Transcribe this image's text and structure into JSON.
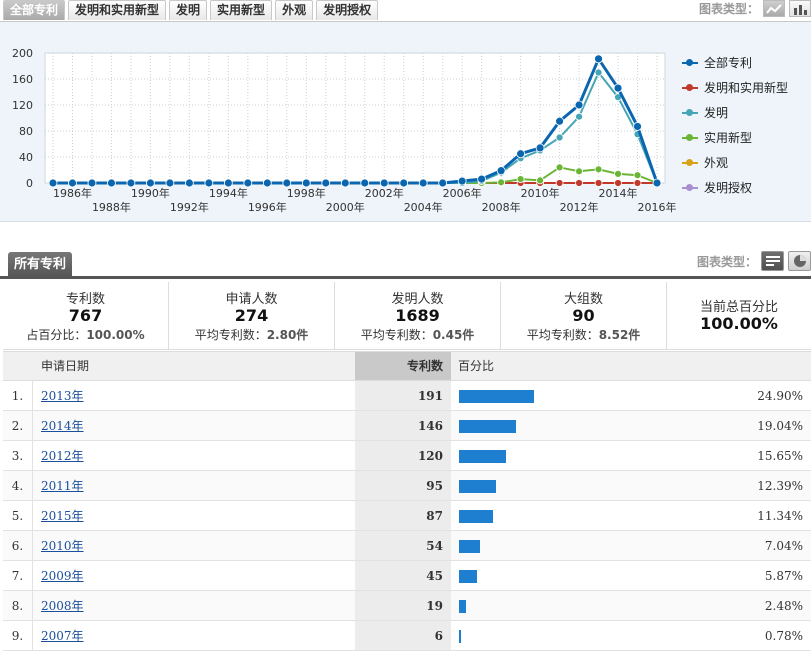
{
  "tabs": [
    "全部专利",
    "发明和实用新型",
    "发明",
    "实用新型",
    "外观",
    "发明授权"
  ],
  "chart_type_label": "图表类型：",
  "chart_data": {
    "type": "line",
    "x": [
      1985,
      1986,
      1987,
      1988,
      1989,
      1990,
      1991,
      1992,
      1993,
      1994,
      1995,
      1996,
      1997,
      1998,
      1999,
      2000,
      2001,
      2002,
      2003,
      2004,
      2005,
      2006,
      2007,
      2008,
      2009,
      2010,
      2011,
      2012,
      2013,
      2014,
      2015,
      2016
    ],
    "x_tick_labels": [
      "1986年",
      "1988年",
      "1990年",
      "1992年",
      "1994年",
      "1996年",
      "1998年",
      "2000年",
      "2002年",
      "2004年",
      "2006年",
      "2008年",
      "2010年",
      "2012年",
      "2014年",
      "2016年"
    ],
    "ylim": [
      0,
      200
    ],
    "y_ticks": [
      0,
      40,
      80,
      120,
      160,
      200
    ],
    "grid": true,
    "legend_position": "right",
    "series": [
      {
        "name": "全部专利",
        "color": "#0b66b0",
        "values": [
          0,
          0,
          0,
          0,
          0,
          0,
          0,
          0,
          0,
          0,
          0,
          0,
          0,
          0,
          0,
          0,
          0,
          0,
          0,
          0,
          0,
          3,
          6,
          19,
          45,
          54,
          95,
          120,
          191,
          146,
          87,
          0
        ]
      },
      {
        "name": "发明和实用新型",
        "color": "#c0392b",
        "values": [
          0,
          0,
          0,
          0,
          0,
          0,
          0,
          0,
          0,
          0,
          0,
          0,
          0,
          0,
          0,
          0,
          0,
          0,
          0,
          0,
          0,
          0,
          0,
          0,
          0,
          0,
          0,
          0,
          0,
          0,
          0,
          0
        ]
      },
      {
        "name": "发明",
        "color": "#45a5b5",
        "values": [
          0,
          0,
          0,
          0,
          0,
          0,
          0,
          0,
          0,
          0,
          0,
          0,
          0,
          0,
          0,
          0,
          0,
          0,
          0,
          0,
          0,
          0,
          3,
          16,
          38,
          50,
          70,
          102,
          170,
          132,
          75,
          0
        ]
      },
      {
        "name": "实用新型",
        "color": "#6ab535",
        "values": [
          0,
          0,
          0,
          0,
          0,
          0,
          0,
          0,
          0,
          0,
          0,
          0,
          0,
          0,
          0,
          0,
          0,
          0,
          0,
          0,
          0,
          0,
          0,
          1,
          6,
          4,
          24,
          18,
          21,
          14,
          12,
          0
        ]
      },
      {
        "name": "外观",
        "color": "#d6a21a",
        "values": [
          0,
          0,
          0,
          0,
          0,
          0,
          0,
          0,
          0,
          0,
          0,
          0,
          0,
          0,
          0,
          0,
          0,
          0,
          0,
          0,
          0,
          0,
          0,
          0,
          0,
          0,
          0,
          0,
          0,
          0,
          0,
          0
        ]
      },
      {
        "name": "发明授权",
        "color": "#a98fd0",
        "values": [
          0,
          0,
          0,
          0,
          0,
          0,
          0,
          0,
          0,
          0,
          0,
          0,
          0,
          0,
          0,
          0,
          0,
          0,
          0,
          0,
          0,
          0,
          0,
          0,
          0,
          0,
          0,
          0,
          0,
          0,
          0,
          0
        ]
      }
    ]
  },
  "section_tab": "所有专利",
  "stats": {
    "patents": {
      "title": "专利数",
      "value": "767",
      "sub_label": "占百分比：",
      "sub_value": "100.00%"
    },
    "applicants": {
      "title": "申请人数",
      "value": "274",
      "sub_label": "平均专利数：",
      "sub_value": "2.80件"
    },
    "inventors": {
      "title": "发明人数",
      "value": "1689",
      "sub_label": "平均专利数：",
      "sub_value": "0.45件"
    },
    "groups": {
      "title": "大组数",
      "value": "90",
      "sub_label": "平均专利数：",
      "sub_value": "8.52件"
    },
    "total": {
      "title": "当前总百分比",
      "value": "100.00%"
    }
  },
  "table": {
    "headers": {
      "date": "申请日期",
      "count": "专利数",
      "pct": "百分比"
    },
    "rows": [
      {
        "num": "1.",
        "date": "2013年",
        "count": "191",
        "pct": "24.90%",
        "share": 0.249
      },
      {
        "num": "2.",
        "date": "2014年",
        "count": "146",
        "pct": "19.04%",
        "share": 0.1904
      },
      {
        "num": "3.",
        "date": "2012年",
        "count": "120",
        "pct": "15.65%",
        "share": 0.1565
      },
      {
        "num": "4.",
        "date": "2011年",
        "count": "95",
        "pct": "12.39%",
        "share": 0.1239
      },
      {
        "num": "5.",
        "date": "2015年",
        "count": "87",
        "pct": "11.34%",
        "share": 0.1134
      },
      {
        "num": "6.",
        "date": "2010年",
        "count": "54",
        "pct": "7.04%",
        "share": 0.0704
      },
      {
        "num": "7.",
        "date": "2009年",
        "count": "45",
        "pct": "5.87%",
        "share": 0.0587
      },
      {
        "num": "8.",
        "date": "2008年",
        "count": "19",
        "pct": "2.48%",
        "share": 0.0248
      },
      {
        "num": "9.",
        "date": "2007年",
        "count": "6",
        "pct": "0.78%",
        "share": 0.0078
      }
    ]
  }
}
